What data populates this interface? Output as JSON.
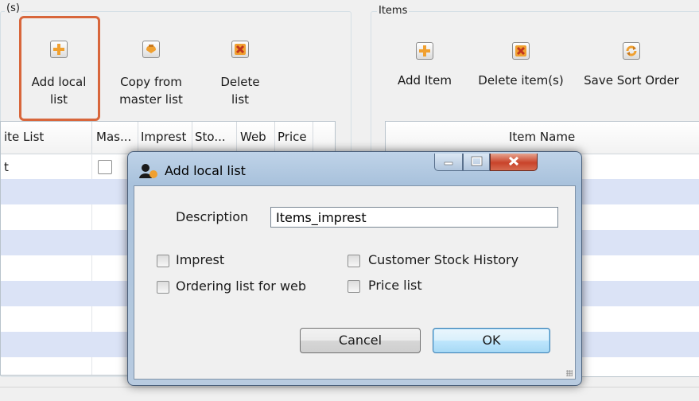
{
  "left_group": {
    "title": "(s)",
    "buttons": [
      {
        "label_line1": "Add local",
        "label_line2": "list",
        "icon": "plus-icon"
      },
      {
        "label_line1": "Copy from",
        "label_line2": "master list",
        "icon": "copy-icon"
      },
      {
        "label_line1": "Delete",
        "label_line2": "list",
        "icon": "delete-icon"
      }
    ],
    "table": {
      "columns": [
        "ite List",
        "Mas...",
        "Imprest",
        "Sto...",
        "Web",
        "Price"
      ],
      "first_row_cell": "t"
    }
  },
  "right_group": {
    "title": "Items",
    "buttons": [
      {
        "label": "Add Item",
        "icon": "plus-icon"
      },
      {
        "label": "Delete item(s)",
        "icon": "delete-icon"
      },
      {
        "label": "Save Sort Order",
        "icon": "refresh-icon"
      }
    ],
    "table": {
      "columns": [
        "Item Name"
      ]
    }
  },
  "dialog": {
    "title": "Add local list",
    "description_label": "Description",
    "description_value": "Items_imprest",
    "checkboxes": {
      "imprest": "Imprest",
      "ordering_web": "Ordering list for web",
      "customer_stock": "Customer Stock History",
      "price_list": "Price list"
    },
    "cancel_label": "Cancel",
    "ok_label": "OK"
  },
  "colors": {
    "highlight": "#d8663b",
    "stripe": "#dbe3f6",
    "icon_orange": "#f0a030",
    "delete_red": "#d84a2a"
  }
}
